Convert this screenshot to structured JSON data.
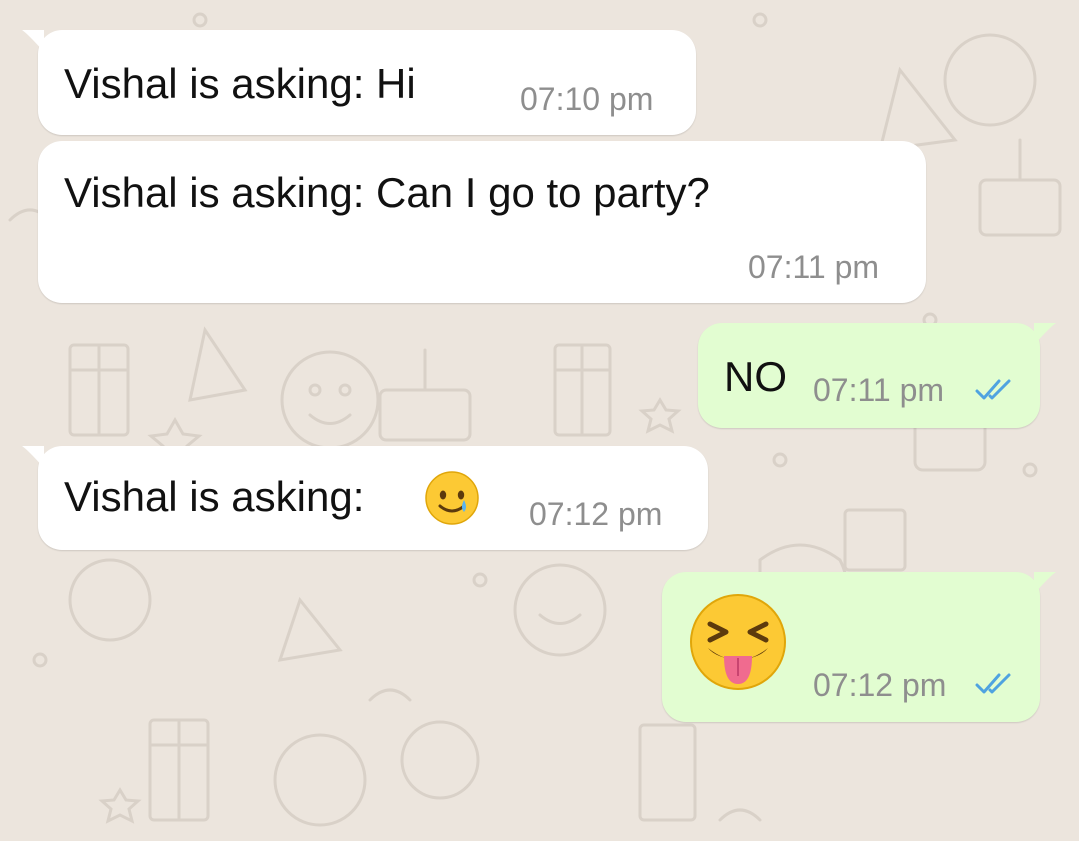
{
  "theme": {
    "wallpaper": "#ece5dd",
    "incoming_bubble": "#ffffff",
    "outgoing_bubble": "#e2fdd1",
    "read_tick_color": "#4fa3e0",
    "time_color": "#8e8e8e",
    "text_color": "#111111"
  },
  "messages": [
    {
      "direction": "incoming",
      "text": "Vishal is asking: Hi",
      "time": "07:10 pm"
    },
    {
      "direction": "incoming",
      "text": "Vishal is asking: Can I go to party?",
      "time": "07:11 pm"
    },
    {
      "direction": "outgoing",
      "text": "NO",
      "time": "07:11 pm",
      "status": "read",
      "status_icon": "double-check-icon"
    },
    {
      "direction": "incoming",
      "text": "Vishal is asking:",
      "emoji": "smiling-face-with-tear",
      "time": "07:12 pm"
    },
    {
      "direction": "outgoing",
      "emoji": "squinting-face-with-tongue",
      "time": "07:12 pm",
      "status": "read",
      "status_icon": "double-check-icon"
    }
  ]
}
